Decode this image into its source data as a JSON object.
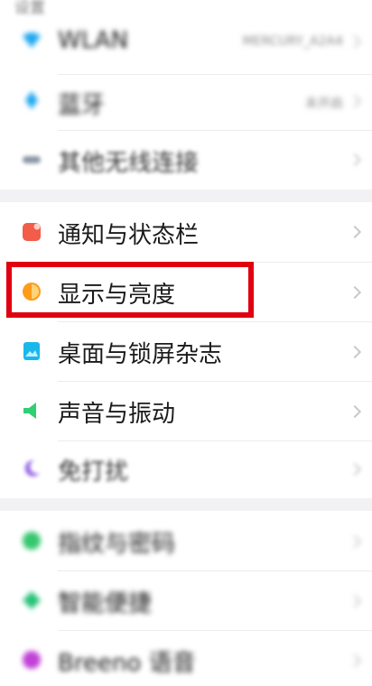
{
  "section_title": "设置",
  "items": [
    {
      "label": "WLAN",
      "value": "MERCURY_A2A4",
      "icon": "wifi-icon",
      "color": "#1ea7f0"
    },
    {
      "label": "蓝牙",
      "value": "未开启",
      "icon": "bluetooth-icon",
      "color": "#1ea7f0"
    },
    {
      "label": "其他无线连接",
      "icon": "link-icon",
      "color": "#7a8a9a"
    },
    {
      "label": "通知与状态栏",
      "icon": "notification-icon",
      "color": "#f25c48"
    },
    {
      "label": "显示与亮度",
      "icon": "brightness-icon",
      "color": "#ff9a1a"
    },
    {
      "label": "桌面与锁屏杂志",
      "icon": "wallpaper-icon",
      "color": "#1ab8ea"
    },
    {
      "label": "声音与振动",
      "icon": "sound-icon",
      "color": "#2fcf73"
    },
    {
      "label": "免打扰",
      "icon": "moon-icon",
      "color": "#9b6be8"
    },
    {
      "label": "指纹与密码",
      "icon": "fingerprint-icon",
      "color": "#35c76e"
    },
    {
      "label": "智能便捷",
      "icon": "smart-icon",
      "color": "#26c277"
    },
    {
      "label": "Breeno 语音",
      "icon": "breeno-icon",
      "color": "#c042d6"
    }
  ],
  "highlight_color": "#e0000f"
}
